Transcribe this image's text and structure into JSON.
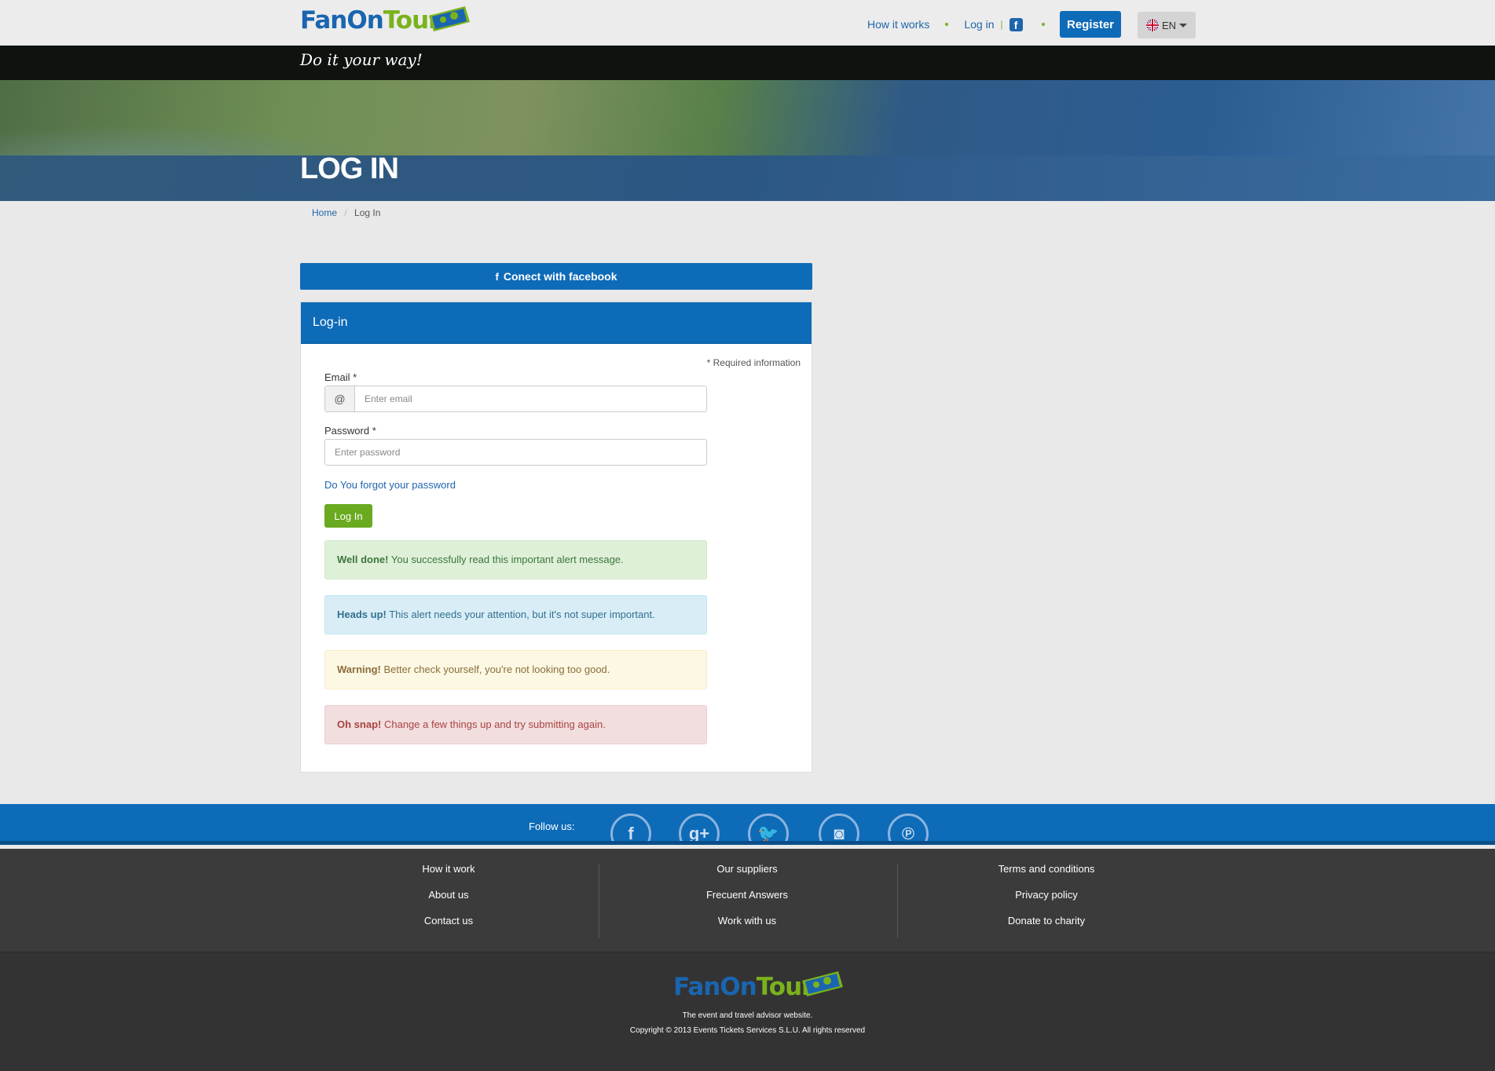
{
  "brand": {
    "name_part1": "FanOn",
    "name_part2": "Tour",
    "tagline": "Do it your way!"
  },
  "nav": {
    "how_it_works": "How it works",
    "login": "Log in",
    "facebook_glyph": "f",
    "register": "Register",
    "language": "EN"
  },
  "hero": {
    "title": "LOG IN"
  },
  "breadcrumb": {
    "home": "Home",
    "separator": "/",
    "current": "Log In"
  },
  "facebook_connect": {
    "label": "Conect with facebook"
  },
  "form": {
    "panel_title": "Log-in",
    "required_note": "* Required information",
    "email_label": "Email *",
    "email_addon": "@",
    "email_placeholder": "Enter email",
    "password_label": "Password *",
    "password_placeholder": "Enter password",
    "forgot_link": "Do You forgot your password",
    "submit": "Log In"
  },
  "alerts": [
    {
      "type": "success",
      "strong": "Well done!",
      "text": "You successfully read this important alert message."
    },
    {
      "type": "info",
      "strong": "Heads up!",
      "text": "This alert needs your attention, but it's not super important."
    },
    {
      "type": "warning",
      "strong": "Warning!",
      "text": "Better check yourself, you're not looking too good."
    },
    {
      "type": "danger",
      "strong": "Oh snap!",
      "text": "Change a few things up and try submitting again."
    }
  ],
  "footer": {
    "follow_label": "Follow us:",
    "social": [
      {
        "name": "facebook-icon",
        "glyph": "f"
      },
      {
        "name": "google-plus-icon",
        "glyph": "g+"
      },
      {
        "name": "twitter-icon",
        "glyph": "🐦"
      },
      {
        "name": "instagram-icon",
        "glyph": "◙"
      },
      {
        "name": "pinterest-icon",
        "glyph": "℗"
      }
    ],
    "col1": [
      "How it work",
      "About us",
      "Contact us"
    ],
    "col2": [
      "Our suppliers",
      "Frecuent Answers",
      "Work with us"
    ],
    "col3": [
      "Terms and conditions",
      "Privacy policy",
      "Donate to charity"
    ],
    "about": "The event and travel advisor website.",
    "copyright": "Copyright © 2013 Events Tickets Services S.L.U. All rights reserved"
  },
  "colors": {
    "primary": "#0e6bb8",
    "accent": "#7ab21d",
    "footer_dark": "#3b3b3b"
  }
}
